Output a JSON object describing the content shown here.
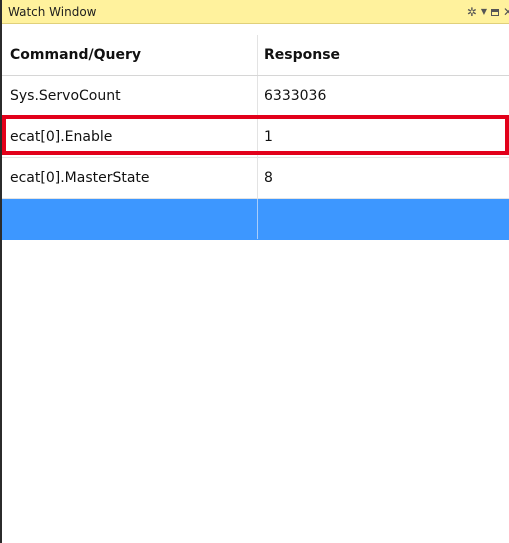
{
  "window": {
    "title": "Watch Window"
  },
  "title_controls": {
    "icons": [
      "gear-icon",
      "dropdown-arrow-icon",
      "restore-icon",
      "close-icon"
    ]
  },
  "grid": {
    "columns": [
      "Command/Query",
      "Response"
    ],
    "rows": [
      {
        "command": "Sys.ServoCount",
        "response": "6333036"
      },
      {
        "command": "ecat[0].Enable",
        "response": "1",
        "highlighted": true
      },
      {
        "command": "ecat[0].MasterState",
        "response": "8"
      },
      {
        "command": "",
        "response": "",
        "selected": true
      }
    ]
  },
  "colors": {
    "titlebar": "#fff29d",
    "selection": "#3d97ff",
    "highlight_border": "#e2001a"
  }
}
